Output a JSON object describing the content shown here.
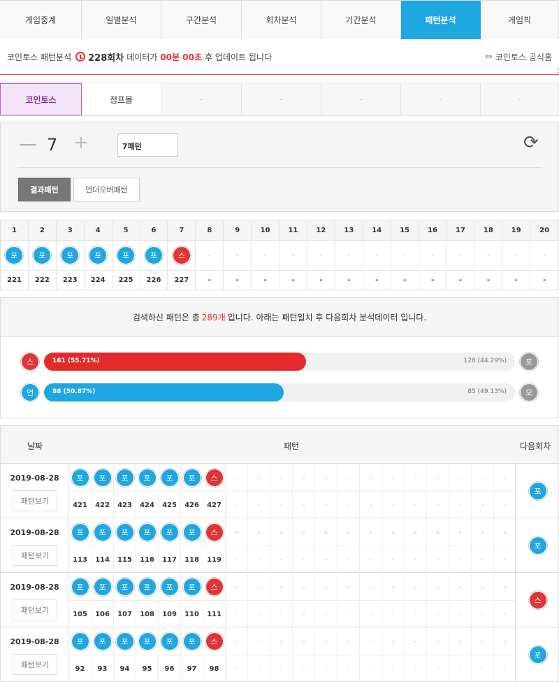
{
  "nav": {
    "tabs": [
      {
        "label": "게임중계"
      },
      {
        "label": "일별분석"
      },
      {
        "label": "구간분석"
      },
      {
        "label": "회차분석"
      },
      {
        "label": "기간분석"
      },
      {
        "label": "패턴분석",
        "active": true
      },
      {
        "label": "게임픽"
      }
    ]
  },
  "info": {
    "prefix": "코인토스 패턴분석",
    "round": "228회차",
    "mid": "데이터가",
    "countdown": "00분 00초",
    "suffix": "후 업데이트 됩니다",
    "official_label": "코인토스 공식홈",
    "official_icon": "link-icon"
  },
  "subtabs": [
    {
      "label": "코인토스",
      "active": true
    },
    {
      "label": "점프볼"
    },
    {
      "label": "-"
    },
    {
      "label": "-"
    },
    {
      "label": "-"
    },
    {
      "label": "-"
    },
    {
      "label": "-"
    }
  ],
  "controls": {
    "count": "7",
    "pattern_select": "7패턴",
    "result_pattern_label": "결과패턴",
    "underover_label": "언더오버패턴"
  },
  "pattern_table": {
    "headers": [
      "1",
      "2",
      "3",
      "4",
      "5",
      "6",
      "7",
      "8",
      "9",
      "10",
      "11",
      "12",
      "13",
      "14",
      "15",
      "16",
      "17",
      "18",
      "19",
      "20"
    ],
    "balls": [
      {
        "label": "포",
        "color": "blue"
      },
      {
        "label": "포",
        "color": "blue"
      },
      {
        "label": "포",
        "color": "blue"
      },
      {
        "label": "포",
        "color": "blue"
      },
      {
        "label": "포",
        "color": "blue"
      },
      {
        "label": "포",
        "color": "blue"
      },
      {
        "label": "스",
        "color": "red"
      },
      null,
      null,
      null,
      null,
      null,
      null,
      null,
      null,
      null,
      null,
      null,
      null,
      null
    ],
    "rounds": [
      "221",
      "222",
      "223",
      "224",
      "225",
      "226",
      "227",
      "-",
      "-",
      "-",
      "-",
      "-",
      "-",
      "-",
      "-",
      "-",
      "-",
      "-",
      "-",
      "-"
    ]
  },
  "stats": {
    "msg_prefix": "검색하신 패턴은 총",
    "total": "289개",
    "msg_suffix": "입니다. 아래는 패턴일치 후 다음회차 분석데이터 입니다.",
    "bars": [
      {
        "left_icon": "스",
        "left_color": "red",
        "right_icon": "포",
        "fill_color": "red",
        "fraction": 0.5571,
        "left_text": "161 (55.71%)",
        "right_text": "128 (44.29%)"
      },
      {
        "left_icon": "언",
        "left_color": "blue",
        "right_icon": "오",
        "fill_color": "blue",
        "fraction": 0.5087,
        "left_text": "88 (50.87%)",
        "right_text": "85 (49.13%)"
      }
    ]
  },
  "history": {
    "col_date": "날짜",
    "col_pattern": "패턴",
    "col_next": "다음회차",
    "view_label": "패턴보기",
    "rows": [
      {
        "date": "2019-08-28",
        "balls": [
          "포",
          "포",
          "포",
          "포",
          "포",
          "포",
          "스"
        ],
        "colors": [
          "blue",
          "blue",
          "blue",
          "blue",
          "blue",
          "blue",
          "red"
        ],
        "rounds": [
          "421",
          "422",
          "423",
          "424",
          "425",
          "426",
          "427"
        ],
        "next": {
          "label": "포",
          "color": "blue"
        }
      },
      {
        "date": "2019-08-28",
        "balls": [
          "포",
          "포",
          "포",
          "포",
          "포",
          "포",
          "스"
        ],
        "colors": [
          "blue",
          "blue",
          "blue",
          "blue",
          "blue",
          "blue",
          "red"
        ],
        "rounds": [
          "113",
          "114",
          "115",
          "116",
          "117",
          "118",
          "119"
        ],
        "next": {
          "label": "포",
          "color": "blue"
        }
      },
      {
        "date": "2019-08-28",
        "balls": [
          "포",
          "포",
          "포",
          "포",
          "포",
          "포",
          "스"
        ],
        "colors": [
          "blue",
          "blue",
          "blue",
          "blue",
          "blue",
          "blue",
          "red"
        ],
        "rounds": [
          "105",
          "106",
          "107",
          "108",
          "109",
          "110",
          "111"
        ],
        "next": {
          "label": "스",
          "color": "red"
        }
      },
      {
        "date": "2019-08-28",
        "balls": [
          "포",
          "포",
          "포",
          "포",
          "포",
          "포",
          "스"
        ],
        "colors": [
          "blue",
          "blue",
          "blue",
          "blue",
          "blue",
          "blue",
          "red"
        ],
        "rounds": [
          "92",
          "93",
          "94",
          "95",
          "96",
          "97",
          "98"
        ],
        "next": {
          "label": "포",
          "color": "blue"
        }
      }
    ]
  },
  "colors": {
    "blue": "#1ea7e1",
    "red": "#e23434",
    "purple": "#8f2fa3"
  }
}
